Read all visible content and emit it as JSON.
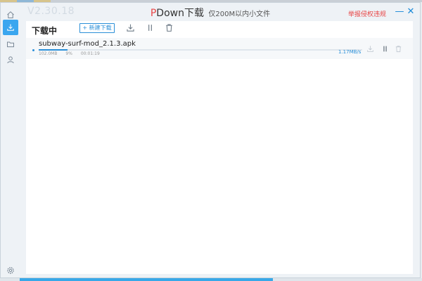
{
  "window": {
    "version": "V2.30.18",
    "title_prefix": "P",
    "title_main": "Down下载",
    "title_sub": "仅200M以内小文件",
    "report_label": "举报侵权违规",
    "minimize_symbol": "—",
    "close_symbol": "✕"
  },
  "sidebar": {
    "items": [
      {
        "icon": "home-icon"
      },
      {
        "icon": "download-icon",
        "active": true
      },
      {
        "icon": "folder-icon"
      },
      {
        "icon": "user-icon"
      },
      {
        "icon": "gear-icon"
      }
    ]
  },
  "toolbar": {
    "section_title": "下载中",
    "new_download_label": "+ 新建下载"
  },
  "downloads": [
    {
      "name": "subway-surf-mod_2.1.3.apk",
      "size": "102.0MB",
      "percent_label": "9%",
      "progress": 0.09,
      "elapsed": "00:01:19",
      "speed": "1.17MB/s"
    }
  ],
  "colors": {
    "accent": "#2a8fd8",
    "sidebar_active": "#3aa6ef",
    "brand_red": "#e84545"
  }
}
